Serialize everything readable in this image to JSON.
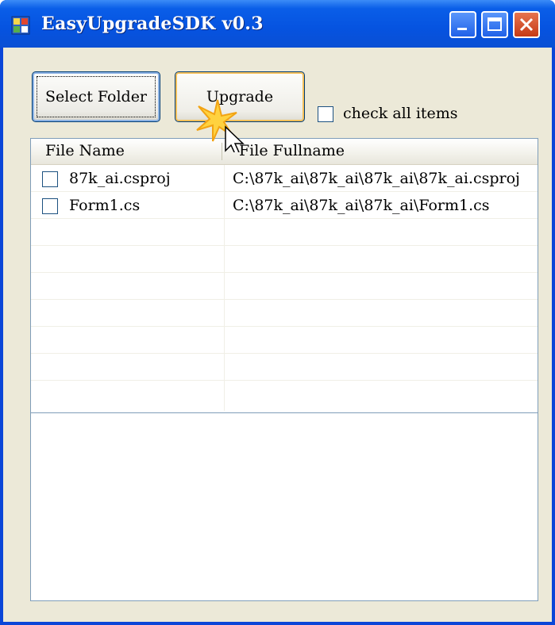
{
  "window": {
    "title": "EasyUpgradeSDK v0.3"
  },
  "toolbar": {
    "select_folder_label": "Select Folder",
    "upgrade_label": "Upgrade",
    "check_all_label": "check all items",
    "check_all_checked": false
  },
  "list": {
    "columns": [
      "File Name",
      "File Fullname"
    ],
    "rows": [
      {
        "name": "87k_ai.csproj",
        "fullname": "C:\\87k_ai\\87k_ai\\87k_ai\\87k_ai.csproj",
        "checked": false
      },
      {
        "name": "Form1.cs",
        "fullname": "C:\\87k_ai\\87k_ai\\87k_ai\\Form1.cs",
        "checked": false
      }
    ],
    "scroll_thumb_grip": "III"
  },
  "output_box": {
    "value": ""
  },
  "colors": {
    "titlebar": "#0653e0",
    "client": "#ece9d8",
    "button_border": "#003c74"
  }
}
